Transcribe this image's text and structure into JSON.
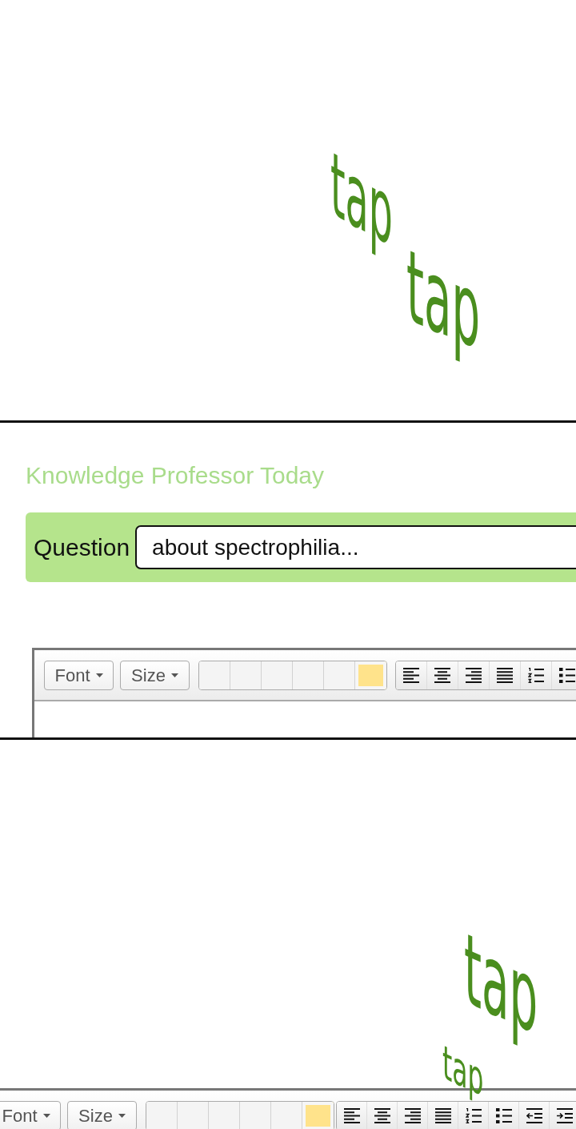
{
  "panels": [
    {
      "kind": "sound-effects",
      "sound_effects": [
        "tap",
        "tap"
      ]
    },
    {
      "kind": "web-form",
      "site_title": "Knowledge Professor Today",
      "question": {
        "label": "Question",
        "value": "about spectrophilia..."
      },
      "editor_toolbar": {
        "dropdowns": [
          "Font",
          "Size"
        ],
        "swatches": [
          {
            "color": "#f4f4f4"
          },
          {
            "color": "#f4f4f4"
          },
          {
            "color": "#f4f4f4"
          },
          {
            "color": "#f4f4f4"
          },
          {
            "color": "#f4f4f4"
          },
          {
            "color": "#ffe38b"
          }
        ],
        "format_buttons": [
          {
            "kind": "align-left"
          },
          {
            "kind": "align-center"
          },
          {
            "kind": "align-right"
          },
          {
            "kind": "justify"
          },
          {
            "kind": "numbered-list"
          },
          {
            "kind": "bullet-list"
          }
        ]
      }
    },
    {
      "kind": "editor-closeup",
      "sound_effects": [
        "tap",
        "tap"
      ],
      "editor_toolbar": {
        "dropdowns": [
          "Font",
          "Size"
        ],
        "swatches": [
          {
            "color": "#f4f4f4"
          },
          {
            "color": "#f4f4f4"
          },
          {
            "color": "#f4f4f4"
          },
          {
            "color": "#f4f4f4"
          },
          {
            "color": "#f4f4f4"
          },
          {
            "color": "#ffe38b"
          }
        ],
        "format_buttons": [
          {
            "kind": "align-left"
          },
          {
            "kind": "align-center"
          },
          {
            "kind": "align-right"
          },
          {
            "kind": "justify"
          },
          {
            "kind": "numbered-list"
          },
          {
            "kind": "bullet-list"
          },
          {
            "kind": "outdent"
          },
          {
            "kind": "indent"
          }
        ]
      }
    }
  ]
}
